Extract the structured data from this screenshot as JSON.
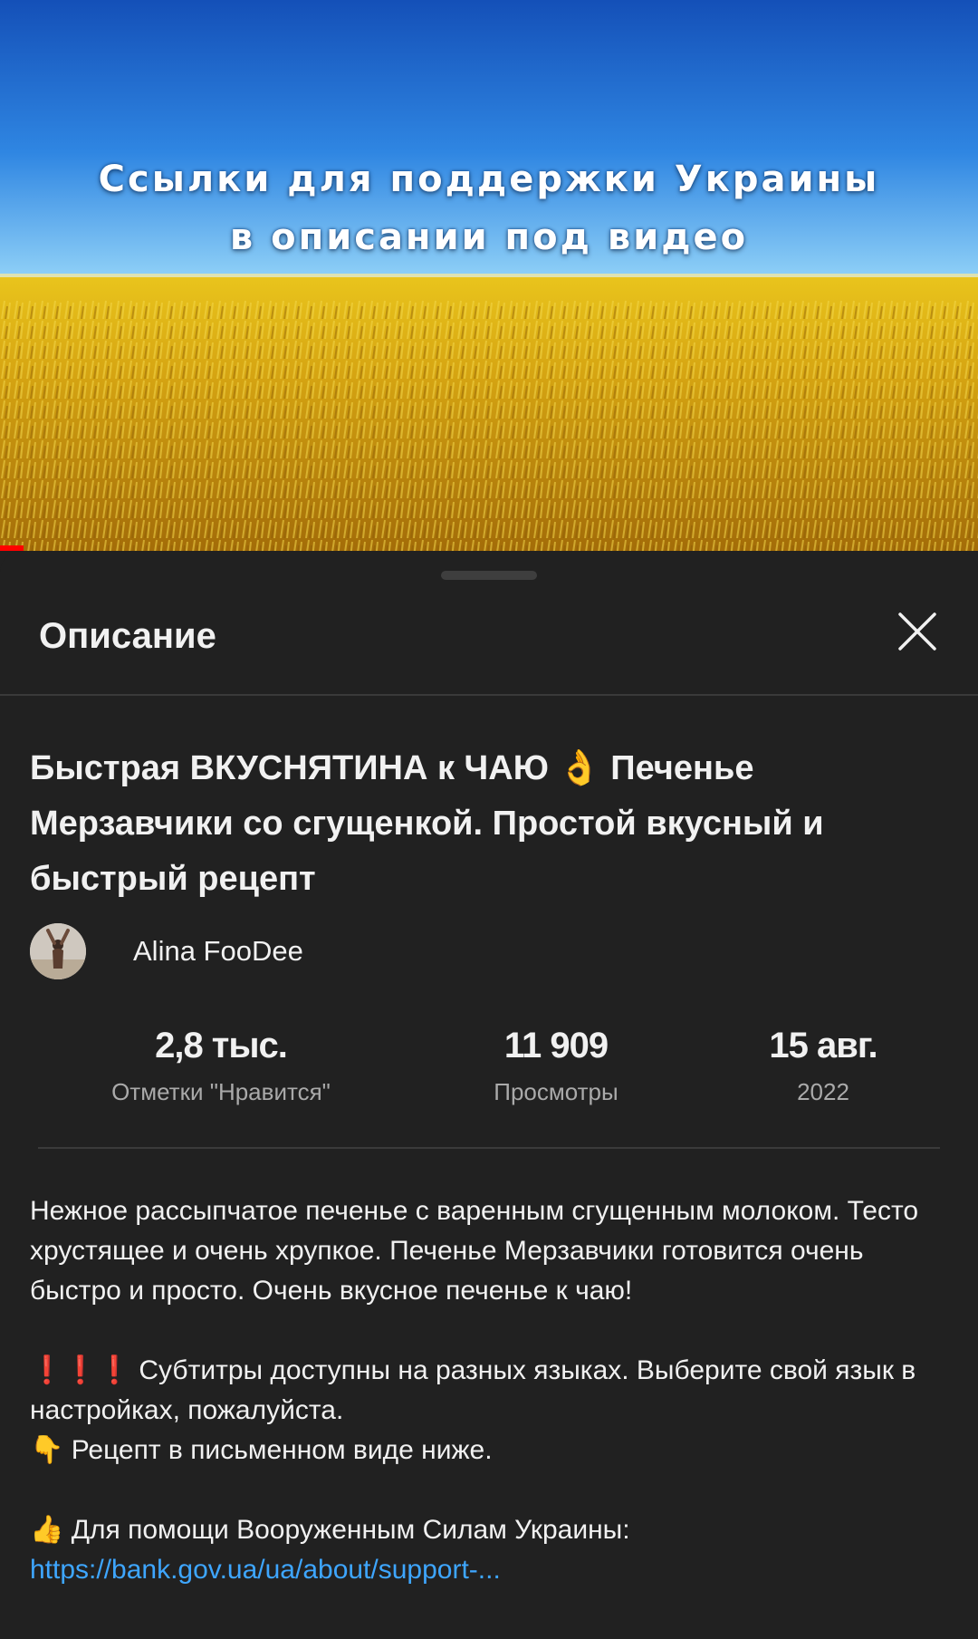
{
  "banner": {
    "line1": "Ссылки для поддержки Украины",
    "line2": "в описании под видео"
  },
  "sheet": {
    "title": "Описание"
  },
  "video": {
    "title": "Быстрая ВКУСНЯТИНА к ЧАЮ 👌 Печенье Мерзавчики со сгущенкой. Простой вкусный и быстрый рецепт",
    "channel": "Alina FooDee"
  },
  "stats": {
    "likes_value": "2,8 тыс.",
    "likes_label": "Отметки \"Нравится\"",
    "views_value": "11 909",
    "views_label": "Просмотры",
    "date_value": "15 авг.",
    "date_year": "2022"
  },
  "description": {
    "para1": "Нежное рассыпчатое печенье с варенным сгущенным молоком. Тесто хрустящее и очень хрупкое. Печенье Мерзавчики готовится очень быстро и просто. Очень вкусное печенье к чаю!",
    "subtitles_line": "❗❗❗ Субтитры доступны на разных языках. Выберите свой язык в настройках, пожалуйста.",
    "recipe_line": "👇 Рецепт в письменном виде ниже.",
    "support_line": "👍 Для помощи Вооруженным Силам Украины:",
    "support_link": "https://bank.gov.ua/ua/about/support-..."
  },
  "colors": {
    "background": "#212121",
    "text": "#f1f1f1",
    "secondary_text": "#aaaaaa",
    "link": "#3ea6ff",
    "progress": "#ff0000"
  },
  "icons": [
    "close-icon"
  ]
}
